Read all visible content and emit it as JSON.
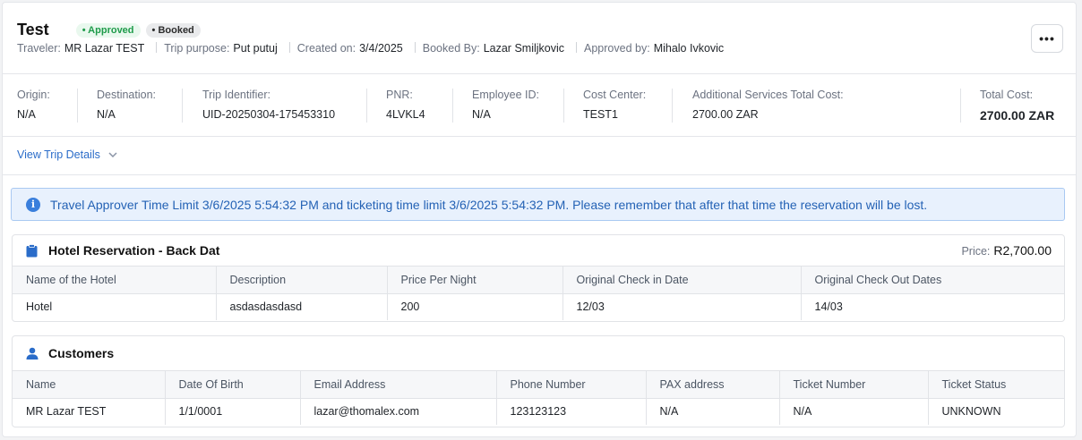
{
  "header": {
    "title": "Test",
    "badges": [
      "• Approved",
      "• Booked"
    ],
    "meta": [
      {
        "label": "Traveler:",
        "value": "MR Lazar TEST"
      },
      {
        "label": "Trip purpose:",
        "value": "Put putuj"
      },
      {
        "label": "Created on:",
        "value": "3/4/2025"
      },
      {
        "label": "Booked By:",
        "value": "Lazar Smiljkovic"
      },
      {
        "label": "Approved by:",
        "value": "Mihalo Ivkovic"
      }
    ],
    "more_label": "•••"
  },
  "info": [
    {
      "label": "Origin:",
      "value": "N/A"
    },
    {
      "label": "Destination:",
      "value": "N/A"
    },
    {
      "label": "Trip Identifier:",
      "value": "UID-20250304-175453310"
    },
    {
      "label": "PNR:",
      "value": "4LVKL4"
    },
    {
      "label": "Employee ID:",
      "value": "N/A"
    },
    {
      "label": "Cost Center:",
      "value": "TEST1"
    },
    {
      "label": "Additional Services Total Cost:",
      "value": "2700.00 ZAR"
    },
    {
      "label": "Total Cost:",
      "value": "2700.00 ZAR"
    }
  ],
  "view_trip_details": "View Trip Details",
  "alert": {
    "icon": "info-icon",
    "text": "Travel Approver Time Limit 3/6/2025 5:54:32 PM and ticketing time limit 3/6/2025 5:54:32 PM. Please remember that after that time the reservation will be lost."
  },
  "hotel": {
    "icon": "clipboard-icon",
    "title": "Hotel Reservation - Back Dat",
    "price_label": "Price:",
    "price_value": "R2,700.00",
    "columns": [
      "Name of the Hotel",
      "Description",
      "Price Per Night",
      "Original Check in Date",
      "Original Check Out Dates"
    ],
    "rows": [
      [
        "Hotel",
        "asdasdasdasd",
        "200",
        "12/03",
        "14/03"
      ]
    ]
  },
  "customers": {
    "icon": "user-icon",
    "title": "Customers",
    "columns": [
      "Name",
      "Date Of Birth",
      "Email Address",
      "Phone Number",
      "PAX address",
      "Ticket Number",
      "Ticket Status"
    ],
    "rows": [
      [
        "MR Lazar TEST",
        "1/1/0001",
        "lazar@thomalex.com",
        "123123123",
        "N/A",
        "N/A",
        "UNKNOWN"
      ]
    ]
  },
  "colors": {
    "accent": "#2a6cc9",
    "approved_green": "#1e9b4a",
    "alert_bg": "#e8f1fd",
    "alert_text": "#2462b5"
  }
}
